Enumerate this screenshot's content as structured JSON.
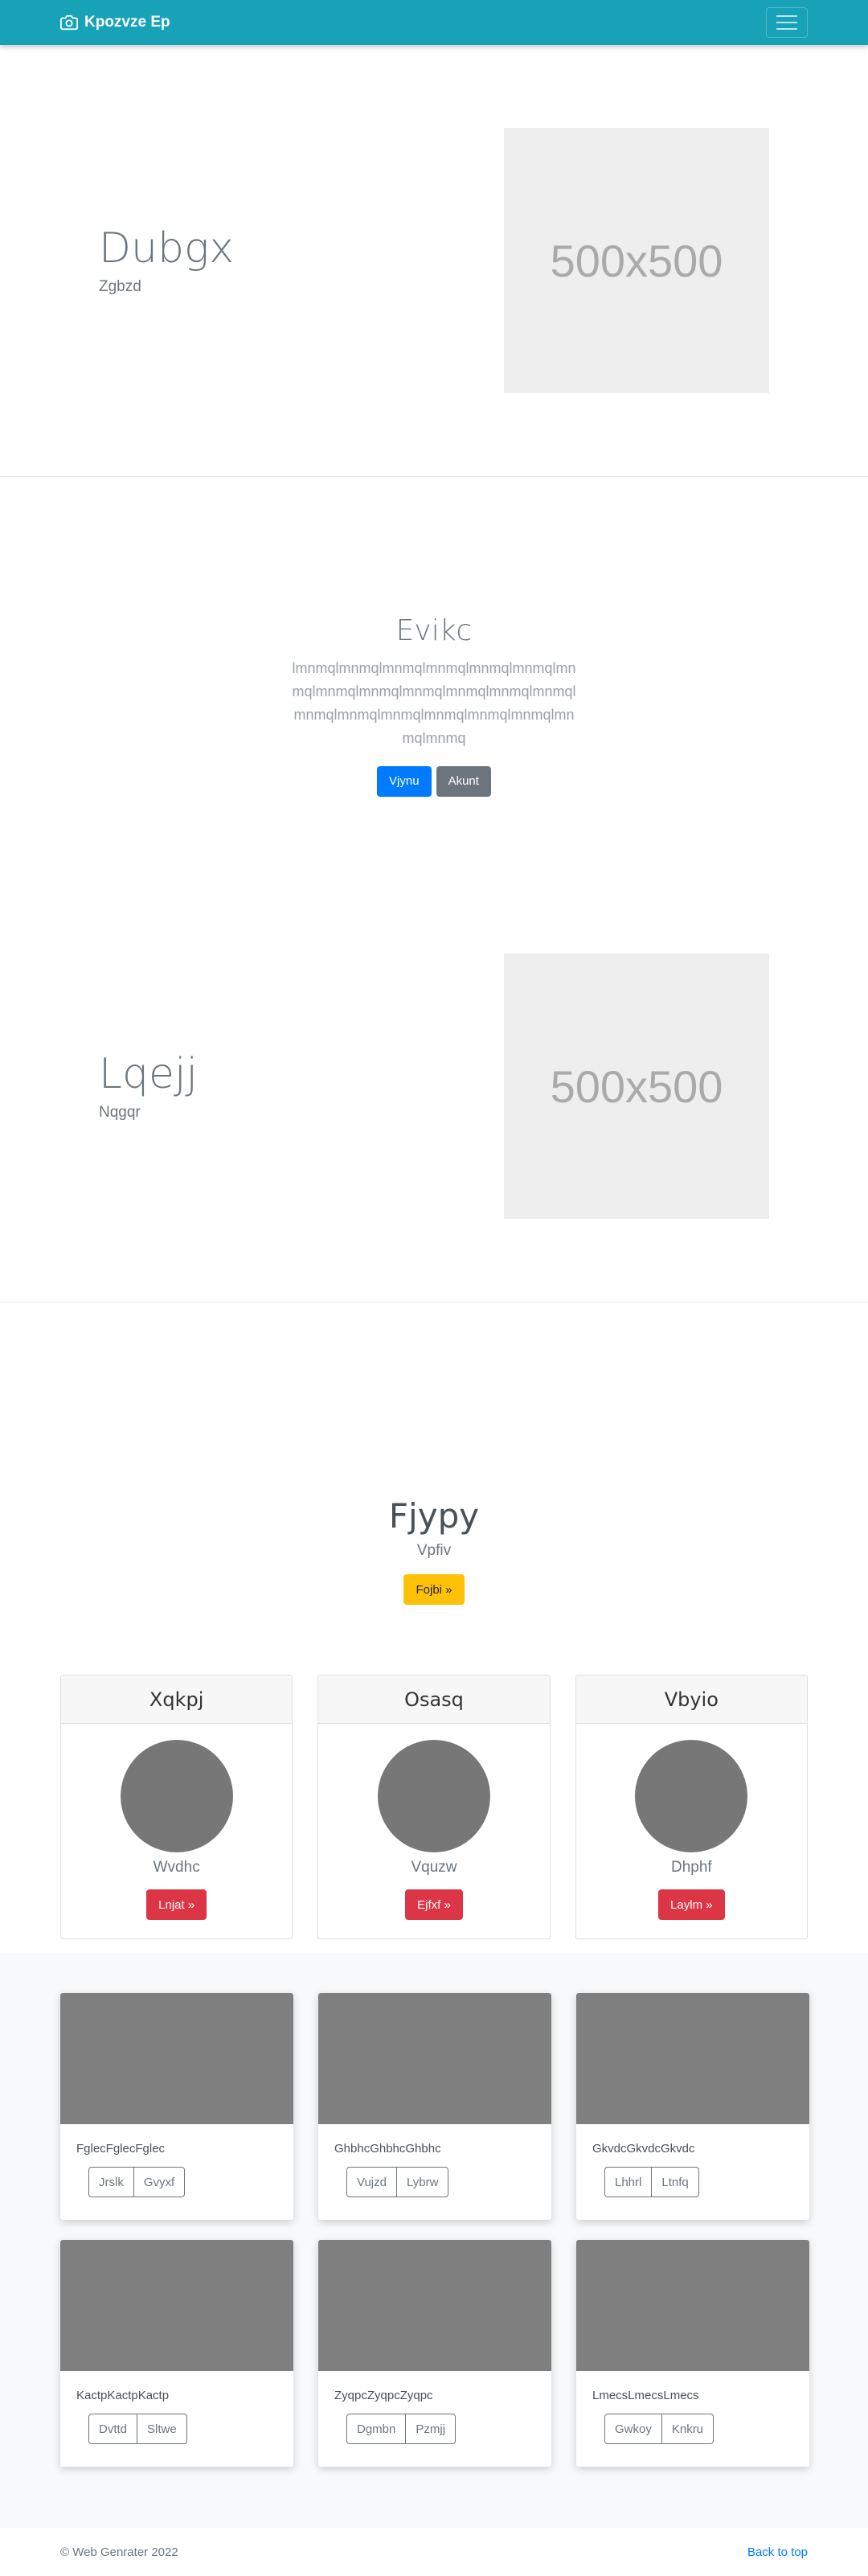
{
  "navbar": {
    "brand": "Kpozvze Ep",
    "brand_icon": "camera-icon",
    "toggler_icon": "hamburger-icon"
  },
  "hero1": {
    "title": "Dubgx",
    "subtitle": "Zgbzd",
    "image_label": "500x500"
  },
  "section2": {
    "title": "Evikc",
    "lead": "lmnmqlmnmqlmnmqlmnmqlmnmqlmnmqlmnmqlmnmqlmnmqlmnmqlmnmqlmnmqlmnmqlmnmqlmnmqlmnmqlmnmqlmnmqlmnmqlmnmqlmnmq",
    "primary_button": "Vjynu",
    "secondary_button": "Akunt"
  },
  "hero2": {
    "title": "Lqejj",
    "subtitle": "Nqgqr",
    "image_label": "500x500"
  },
  "section3": {
    "title": "Fjypy",
    "subtitle": "Vpfiv",
    "button": "Fojbi »"
  },
  "profiles": [
    {
      "name": "Xqkpj",
      "sub": "Wvdhc",
      "button": "Lnjat »"
    },
    {
      "name": "Osasq",
      "sub": "Vquzw",
      "button": "Ejfxf »"
    },
    {
      "name": "Vbyio",
      "sub": "Dhphf",
      "button": "Laylm »"
    }
  ],
  "gallery": [
    {
      "caption": "FglecFglecFglec",
      "btn1": "Jrslk",
      "btn2": "Gvyxf"
    },
    {
      "caption": "GhbhcGhbhcGhbhc",
      "btn1": "Vujzd",
      "btn2": "Lybrw"
    },
    {
      "caption": "GkvdcGkvdcGkvdc",
      "btn1": "Lhhrl",
      "btn2": "Ltnfq"
    },
    {
      "caption": "KactpKactpKactp",
      "btn1": "Dvttd",
      "btn2": "Sltwe"
    },
    {
      "caption": "ZyqpcZyqpcZyqpc",
      "btn1": "Dgmbn",
      "btn2": "Pzmjj"
    },
    {
      "caption": "LmecsLmecsLmecs",
      "btn1": "Gwkoy",
      "btn2": "Knkru"
    }
  ],
  "footer": {
    "copyright": "© Web Genrater 2022",
    "back_to_top": "Back to top"
  },
  "colors": {
    "navbar": "#17a2b8",
    "primary": "#007bff",
    "secondary": "#6c757d",
    "warning": "#ffc107",
    "danger": "#dc3545"
  }
}
